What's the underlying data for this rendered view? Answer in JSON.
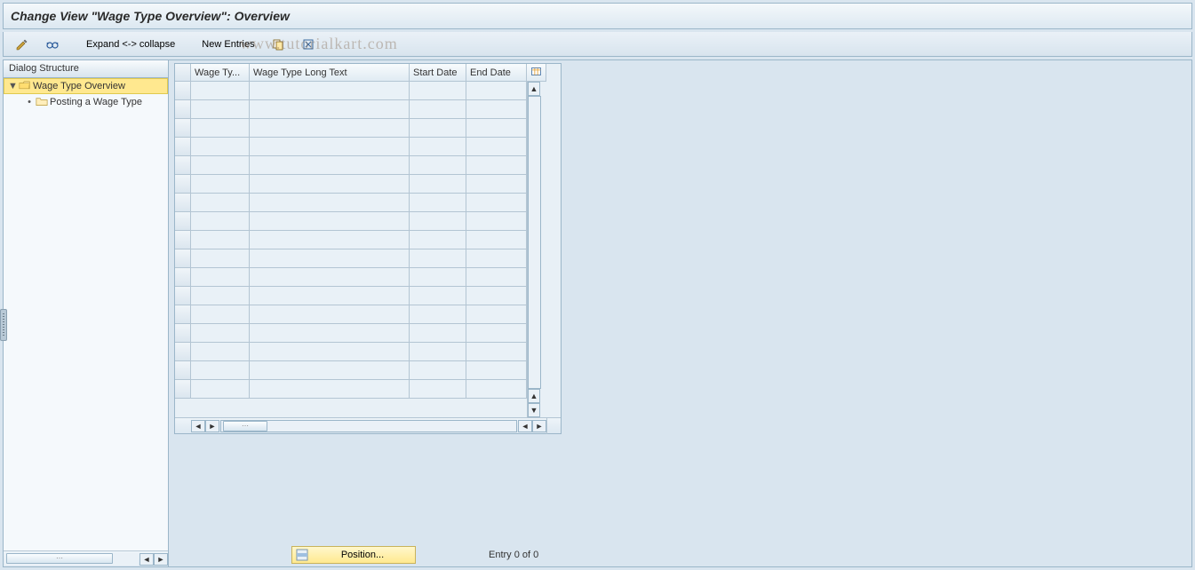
{
  "title": "Change View \"Wage Type Overview\": Overview",
  "toolbar": {
    "expand_collapse_label": "Expand <-> collapse",
    "new_entries_label": "New Entries"
  },
  "tree": {
    "header": "Dialog Structure",
    "root_label": "Wage Type Overview",
    "child_label": "Posting a Wage Type"
  },
  "grid": {
    "columns": {
      "wage_type": "Wage Ty...",
      "long_text": "Wage Type Long Text",
      "start_date": "Start Date",
      "end_date": "End Date"
    },
    "rows": [
      {
        "wage_type": "",
        "long_text": "",
        "start_date": "",
        "end_date": ""
      },
      {
        "wage_type": "",
        "long_text": "",
        "start_date": "",
        "end_date": ""
      },
      {
        "wage_type": "",
        "long_text": "",
        "start_date": "",
        "end_date": ""
      },
      {
        "wage_type": "",
        "long_text": "",
        "start_date": "",
        "end_date": ""
      },
      {
        "wage_type": "",
        "long_text": "",
        "start_date": "",
        "end_date": ""
      },
      {
        "wage_type": "",
        "long_text": "",
        "start_date": "",
        "end_date": ""
      },
      {
        "wage_type": "",
        "long_text": "",
        "start_date": "",
        "end_date": ""
      },
      {
        "wage_type": "",
        "long_text": "",
        "start_date": "",
        "end_date": ""
      },
      {
        "wage_type": "",
        "long_text": "",
        "start_date": "",
        "end_date": ""
      },
      {
        "wage_type": "",
        "long_text": "",
        "start_date": "",
        "end_date": ""
      },
      {
        "wage_type": "",
        "long_text": "",
        "start_date": "",
        "end_date": ""
      },
      {
        "wage_type": "",
        "long_text": "",
        "start_date": "",
        "end_date": ""
      },
      {
        "wage_type": "",
        "long_text": "",
        "start_date": "",
        "end_date": ""
      },
      {
        "wage_type": "",
        "long_text": "",
        "start_date": "",
        "end_date": ""
      },
      {
        "wage_type": "",
        "long_text": "",
        "start_date": "",
        "end_date": ""
      },
      {
        "wage_type": "",
        "long_text": "",
        "start_date": "",
        "end_date": ""
      },
      {
        "wage_type": "",
        "long_text": "",
        "start_date": "",
        "end_date": ""
      }
    ]
  },
  "footer": {
    "position_label": "Position...",
    "entry_status": "Entry 0 of 0"
  },
  "watermark": "www.tutorialkart.com"
}
